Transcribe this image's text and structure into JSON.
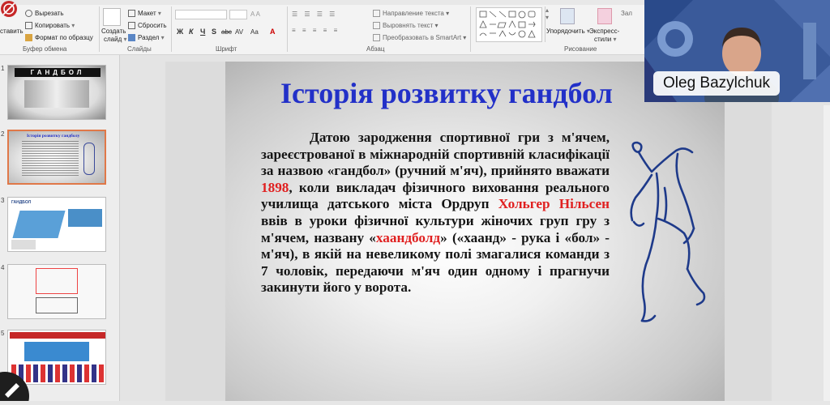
{
  "ribbon": {
    "clipboard": {
      "paste": "ставить",
      "cut": "Вырезать",
      "copy": "Копировать",
      "format_painter": "Формат по образцу",
      "group_label": "Буфер обмена"
    },
    "slides": {
      "new_slide_line1": "Создать",
      "new_slide_line2": "слайд",
      "layout": "Макет",
      "reset": "Сбросить",
      "section": "Раздел",
      "group_label": "Слайды"
    },
    "font": {
      "bold": "Ж",
      "italic": "К",
      "underline": "Ч",
      "shadow": "S",
      "strike": "abc",
      "spacing": "AV",
      "case": "Aa",
      "color": "A",
      "group_label": "Шрифт"
    },
    "paragraph": {
      "text_direction": "Направление текста",
      "align_text": "Выровнять текст",
      "smartart": "Преобразовать в SmartArt",
      "group_label": "Абзац"
    },
    "drawing": {
      "arrange": "Упорядочить",
      "quick_styles_line1": "Экспресс-",
      "quick_styles_line2": "стили",
      "group_label": "Рисование"
    },
    "partial_right": "Зал"
  },
  "thumbnails": [
    {
      "num": "1",
      "title": "ГАНДБОЛ"
    },
    {
      "num": "2",
      "title": "Історія розвитку гандболу"
    },
    {
      "num": "3",
      "title": "ГАНДБОЛ"
    },
    {
      "num": "4",
      "title": ""
    },
    {
      "num": "5",
      "title": ""
    }
  ],
  "slide": {
    "title": "Історія розвитку гандбол",
    "text_a": "Датою зародження спортивної гри з м'ячем, зареєстрованої в міжнародній спортивній класифікації за назвою «гандбол» (ручний м'яч), прийнято вважати ",
    "year": "1898",
    "text_b": ", коли викладач фізичного виховання реального училища датського міста Ордруп ",
    "person": "Хольгер Нільсен",
    "text_c": " ввів в уроки фізичної культури жіночих груп гру з м'ячем, названу «",
    "game_name": "хаандболд",
    "text_d": "» («хаанд» - рука і «бол» - м'яч), в якій на невеликому полі змагалися команди з 7 чоловік, передаючи м'яч один одному і прагнучи закинути його у ворота."
  },
  "video": {
    "participant_name": "Oleg Bazylchuk"
  },
  "colors": {
    "title_blue": "#2230c8",
    "highlight_red": "#e02020",
    "selected_thumb": "#e07848"
  }
}
